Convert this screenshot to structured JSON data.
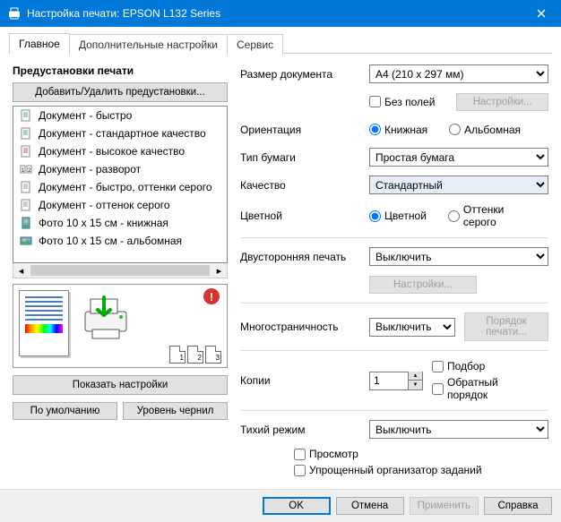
{
  "window": {
    "title": "Настройка печати: EPSON L132 Series"
  },
  "tabs": {
    "main": "Главное",
    "more": "Дополнительные настройки",
    "service": "Сервис"
  },
  "left": {
    "presets_title": "Предустановки печати",
    "add_remove": "Добавить/Удалить предустановки...",
    "presets": [
      "Документ - быстро",
      "Документ - стандартное качество",
      "Документ - высокое качество",
      "Документ - разворот",
      "Документ - быстро, оттенки серого",
      "Документ - оттенок серого",
      "Фото 10 x 15 см - книжная",
      "Фото 10 x 15 см - альбомная"
    ],
    "show_settings": "Показать настройки",
    "defaults": "По умолчанию",
    "ink_levels": "Уровень чернил"
  },
  "right": {
    "doc_size_label": "Размер документа",
    "doc_size": "A4 (210 x 297 мм)",
    "borderless": "Без полей",
    "settings_btn": "Настройки...",
    "orientation_label": "Ориентация",
    "orientation_portrait": "Книжная",
    "orientation_landscape": "Альбомная",
    "paper_type_label": "Тип бумаги",
    "paper_type": "Простая бумага",
    "quality_label": "Качество",
    "quality": "Стандартный",
    "color_label": "Цветной",
    "color_color": "Цветной",
    "color_gray": "Оттенки серого",
    "duplex_label": "Двусторонняя печать",
    "duplex": "Выключить",
    "duplex_settings": "Настройки...",
    "multi_label": "Многостраничность",
    "multi": "Выключить",
    "print_order": "Порядок печати...",
    "copies_label": "Копии",
    "copies": "1",
    "collate": "Подбор",
    "reverse": "Обратный порядок",
    "quiet_label": "Тихий режим",
    "quiet": "Выключить",
    "preview_chk": "Просмотр",
    "simplified": "Упрощенный организатор заданий"
  },
  "footer": {
    "ok": "OK",
    "cancel": "Отмена",
    "apply": "Применить",
    "help": "Справка"
  }
}
